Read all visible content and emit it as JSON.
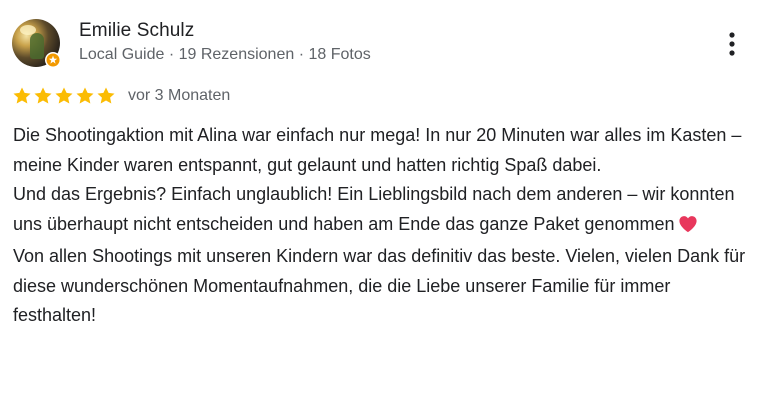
{
  "author": {
    "name": "Emilie Schulz",
    "meta": "Local Guide · 19 Rezensionen · 18 Fotos"
  },
  "rating": {
    "stars": 5,
    "max": 5,
    "date": "vor 3 Monaten"
  },
  "review": {
    "paragraph1": "Die Shootingaktion mit Alina war einfach nur mega! In nur 20 Minuten war alles im Kasten – meine Kinder waren entspannt, gut gelaunt und hatten richtig Spaß dabei.",
    "paragraph2": "Und das Ergebnis? Einfach unglaublich! Ein Lieblingsbild nach dem anderen – wir konnten uns überhaupt nicht entscheiden und haben am Ende das ganze Paket genommen",
    "paragraph3": "Von allen Shootings mit unseren Kindern war das definitiv das beste. Vielen, vielen Dank für diese wunderschönen Momentaufnahmen, die die Liebe unserer Familie für immer festhalten!"
  },
  "icons": {
    "star": "star-icon",
    "heart": "heart-icon",
    "more": "more-vert-icon",
    "badge": "local-guide-badge-icon"
  },
  "colors": {
    "star": "#fbbc04",
    "heart": "#e8375c",
    "badge": "#f29900",
    "secondary_text": "#5f6368"
  }
}
